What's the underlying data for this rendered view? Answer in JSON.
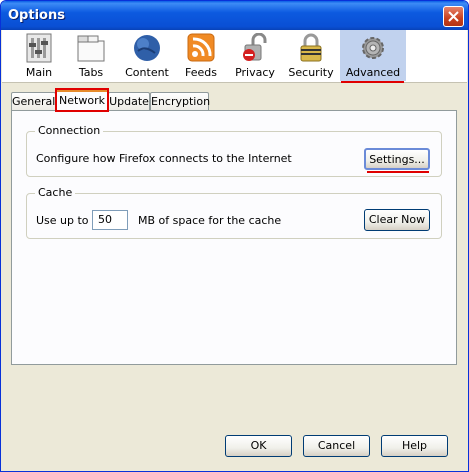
{
  "window": {
    "title": "Options"
  },
  "toolbar": {
    "items": [
      {
        "label": "Main",
        "icon": "main-icon"
      },
      {
        "label": "Tabs",
        "icon": "tabs-icon"
      },
      {
        "label": "Content",
        "icon": "content-icon"
      },
      {
        "label": "Feeds",
        "icon": "feeds-icon"
      },
      {
        "label": "Privacy",
        "icon": "privacy-icon"
      },
      {
        "label": "Security",
        "icon": "security-icon"
      },
      {
        "label": "Advanced",
        "icon": "advanced-icon",
        "selected": true
      }
    ]
  },
  "tabs": [
    {
      "label": "General"
    },
    {
      "label": "Network",
      "active": true
    },
    {
      "label": "Update"
    },
    {
      "label": "Encryption"
    }
  ],
  "connection": {
    "title": "Connection",
    "description": "Configure how Firefox connects to the Internet",
    "settings_label": "Settings..."
  },
  "cache": {
    "title": "Cache",
    "use_up_to_label": "Use up to",
    "size_value": "50",
    "unit_label": "MB of space for the cache",
    "clear_label": "Clear Now"
  },
  "footer": {
    "ok_label": "OK",
    "cancel_label": "Cancel",
    "help_label": "Help"
  },
  "colors": {
    "highlight": "#e00000",
    "selected_bg": "#c1d2ee",
    "titlebar": "#0a4fd4"
  }
}
